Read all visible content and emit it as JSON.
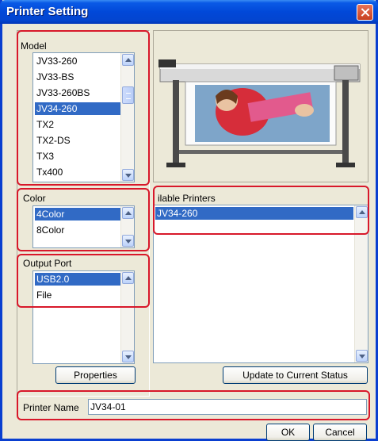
{
  "window": {
    "title": "Printer Setting"
  },
  "model": {
    "label": "Model",
    "items": [
      "JV33-260",
      "JV33-BS",
      "JV33-260BS",
      "JV34-260",
      "TX2",
      "TX2-DS",
      "TX3",
      "Tx400"
    ],
    "selected": "JV34-260"
  },
  "color": {
    "label": "Color",
    "items": [
      "4Color",
      "8Color"
    ],
    "selected": "4Color"
  },
  "output_port": {
    "label": "Output Port",
    "items": [
      "USB2.0",
      "File"
    ],
    "selected": "USB2.0"
  },
  "available_printers": {
    "label": "ilable Printers",
    "items": [
      "JV34-260"
    ],
    "selected": "JV34-260"
  },
  "buttons": {
    "properties": "Properties",
    "update": "Update to Current Status",
    "ok": "OK",
    "cancel": "Cancel"
  },
  "printer_name": {
    "label": "Printer Name",
    "value": "JV34-01"
  },
  "colors": {
    "titlebar": "#0148d8",
    "selection": "#316ac5",
    "highlight": "#d8182a",
    "dialog": "#ece9d8"
  }
}
